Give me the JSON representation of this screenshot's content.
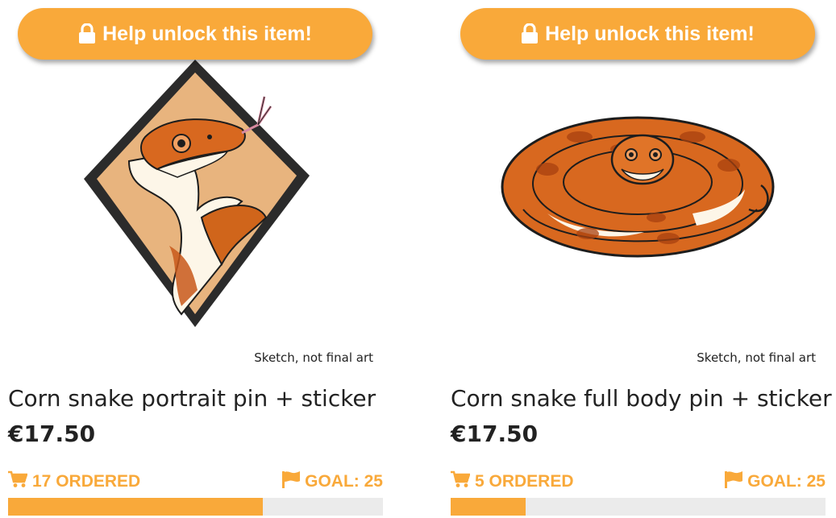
{
  "accent_color": "#f9a93a",
  "track_color": "#ebebeb",
  "products": [
    {
      "unlock_label": "Help unlock this item!",
      "sketch_note": "Sketch, not final art",
      "title": "Corn snake portrait pin + sticker",
      "price": "€17.50",
      "ordered_label": "17 ORDERED",
      "goal_label": "GOAL: 25",
      "ordered": 17,
      "goal": 25,
      "icons": {
        "lock": "lock-icon",
        "cart": "cart-icon",
        "flag": "flag-icon"
      }
    },
    {
      "unlock_label": "Help unlock this item!",
      "sketch_note": "Sketch, not final art",
      "title": "Corn snake full body pin + sticker",
      "price": "€17.50",
      "ordered_label": "5 ORDERED",
      "goal_label": "GOAL: 25",
      "ordered": 5,
      "goal": 25,
      "icons": {
        "lock": "lock-icon",
        "cart": "cart-icon",
        "flag": "flag-icon"
      }
    }
  ]
}
